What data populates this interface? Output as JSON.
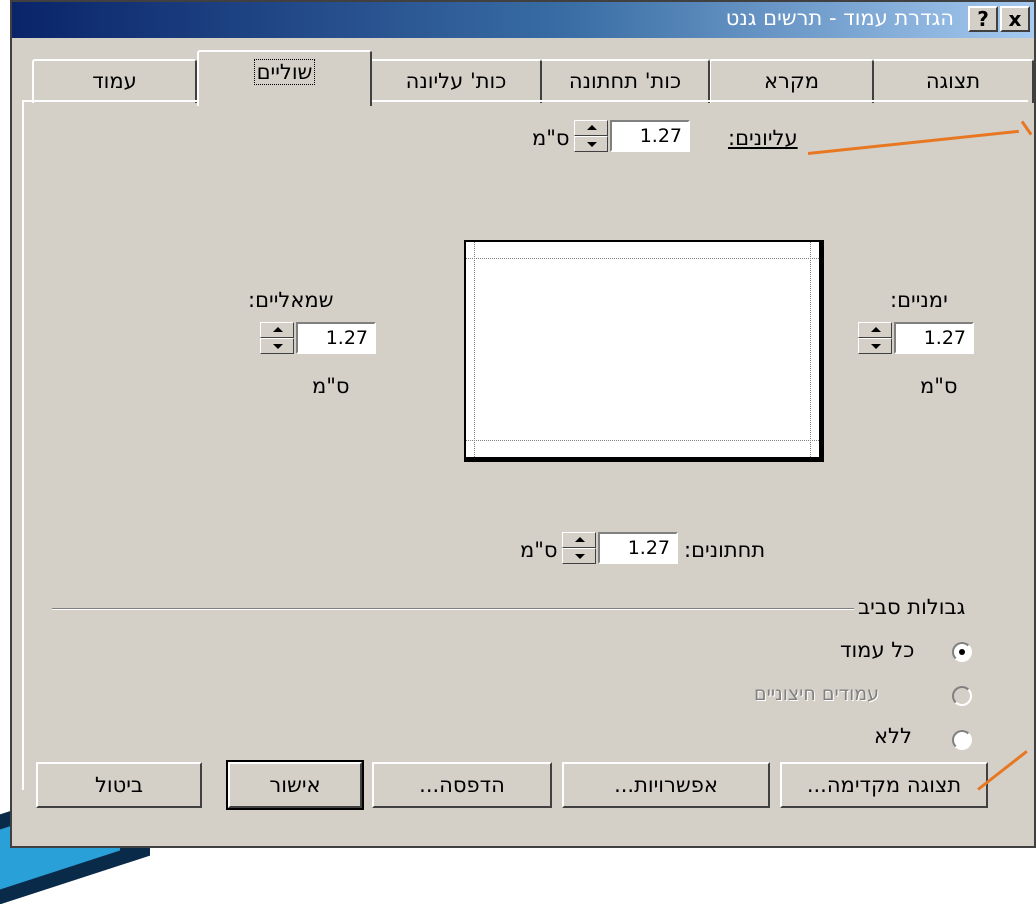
{
  "window": {
    "title": "הגדרת עמוד - תרשים גנט",
    "help_label": "?",
    "close_label": "x"
  },
  "tabs": [
    {
      "label": "תצוגה",
      "active": false
    },
    {
      "label": "מקרא",
      "active": false
    },
    {
      "label": "כות' תחתונה",
      "active": false
    },
    {
      "label": "כות' עליונה",
      "active": false
    },
    {
      "label": "שוליים",
      "active": true
    },
    {
      "label": "עמוד",
      "active": false
    }
  ],
  "margins": {
    "top": {
      "label": "עליונים:",
      "value": "1.27",
      "unit": "ס\"מ"
    },
    "right": {
      "label": "ימניים:",
      "value": "1.27",
      "unit": "ס\"מ"
    },
    "left": {
      "label": "שמאליים:",
      "value": "1.27",
      "unit": "ס\"מ"
    },
    "bottom": {
      "label": "תחתונים:",
      "value": "1.27",
      "unit": "ס\"מ"
    }
  },
  "borders_group": {
    "title": "גבולות סביב",
    "options": [
      {
        "label": "כל עמוד",
        "checked": true,
        "disabled": false
      },
      {
        "label": "עמודים חיצוניים",
        "checked": false,
        "disabled": true
      },
      {
        "label": "ללא",
        "checked": false,
        "disabled": false
      }
    ]
  },
  "buttons": {
    "print_preview": "תצוגה מקדימה...",
    "options": "אפשרויות...",
    "print": "הדפסה...",
    "ok": "אישור",
    "cancel": "ביטול"
  },
  "colors": {
    "callout": "#e87722",
    "titlebar_start": "#0a246a",
    "titlebar_end": "#a6caf0",
    "dialog_bg": "#d4d0c8"
  }
}
